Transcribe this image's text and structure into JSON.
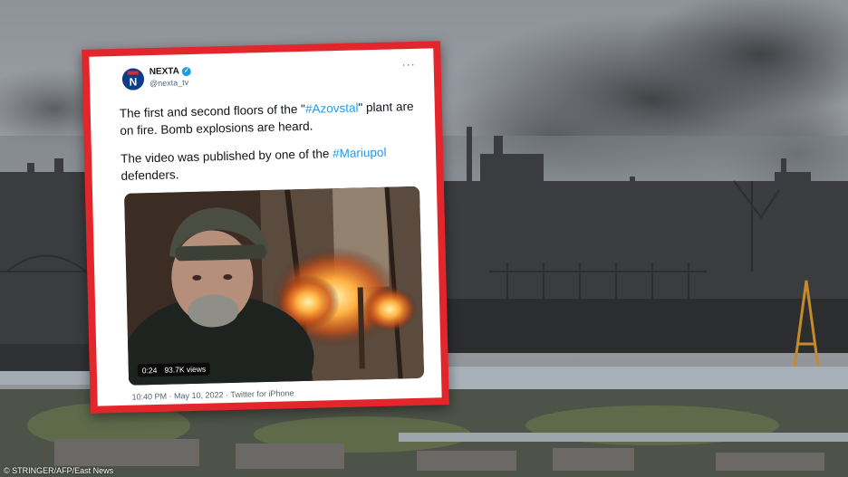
{
  "tweet": {
    "author_name": "NEXTA",
    "author_handle": "@nexta_tv",
    "text_p1_part1": "The first and second floors of the \"",
    "text_p1_tag": "#Azovstal",
    "text_p1_part2": "\" plant are on fire. Bomb explosions are heard.",
    "text_p2_part1": "The video was published by one of the ",
    "text_p2_tag": "#Mariupol",
    "text_p2_part2": " defenders.",
    "video_duration": "0:24",
    "video_views": "93.7K views",
    "meta": "10:40 PM · May 10, 2022 · Twitter for iPhone"
  },
  "photo_credit": "STRINGER/AFP/East News",
  "colors": {
    "frame_red": "#e3262b",
    "link_blue": "#1d9bf0",
    "smoke_gray": "#5c5f63"
  }
}
